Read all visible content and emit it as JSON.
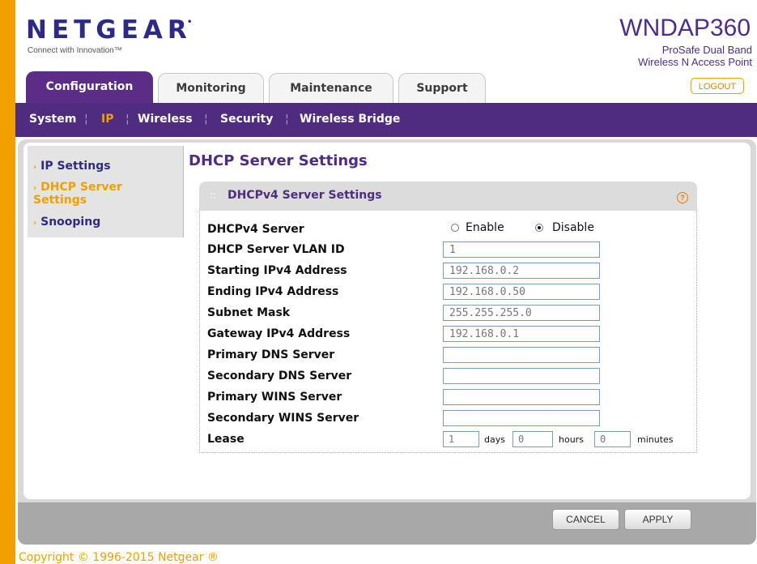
{
  "brand": {
    "logo": "NETGEAR",
    "tagline": "Connect with Innovation™",
    "model": "WNDAP360",
    "product_line1": "ProSafe Dual Band",
    "product_line2": "Wireless N Access Point",
    "logout": "LOGOUT"
  },
  "tabs": [
    "Configuration",
    "Monitoring",
    "Maintenance",
    "Support"
  ],
  "subnav": [
    "System",
    "IP",
    "Wireless",
    "Security",
    "Wireless Bridge"
  ],
  "sidebar": [
    "IP Settings",
    "DHCP Server Settings",
    "Snooping"
  ],
  "page_title": "DHCP Server Settings",
  "section_title": "DHCPv4 Server Settings",
  "help_icon": "?",
  "form": {
    "dhcp_server_label": "DHCPv4 Server",
    "enable_label": "Enable",
    "disable_label": "Disable",
    "selected": "Disable",
    "rows": [
      {
        "label": "DHCP Server VLAN ID",
        "value": "1"
      },
      {
        "label": "Starting IPv4 Address",
        "value": "192.168.0.2"
      },
      {
        "label": "Ending IPv4 Address",
        "value": "192.168.0.50"
      },
      {
        "label": "Subnet Mask",
        "value": "255.255.255.0"
      },
      {
        "label": "Gateway IPv4 Address",
        "value": "192.168.0.1"
      },
      {
        "label": "Primary DNS Server",
        "value": ""
      },
      {
        "label": "Secondary DNS Server",
        "value": ""
      },
      {
        "label": "Primary WINS Server",
        "value": ""
      },
      {
        "label": "Secondary WINS Server",
        "value": ""
      }
    ],
    "lease": {
      "label": "Lease",
      "days": "1",
      "days_label": "days",
      "hours": "0",
      "hours_label": "hours",
      "minutes": "0",
      "minutes_label": "minutes"
    }
  },
  "buttons": {
    "cancel": "CANCEL",
    "apply": "APPLY"
  },
  "copyright": "Copyright © 1996-2015 Netgear ®",
  "colors": {
    "purple": "#4f2c7f",
    "orange": "#f2a000",
    "panel_grey": "#d8d8d8"
  }
}
